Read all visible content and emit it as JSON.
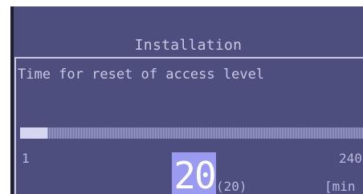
{
  "screen": {
    "title": "Installation",
    "parameter": {
      "label": "Time for reset of access level",
      "min_label": "1",
      "max_label": "240",
      "current_value": "20",
      "default_value": "(20)",
      "unit": "[min"
    },
    "slider": {
      "min": 1,
      "max": 240,
      "value": 20,
      "fill_fraction": 0.08
    }
  },
  "colors": {
    "background": "#4e4e7e",
    "text": "#c8c8e4",
    "value_highlight": "#9a9af0",
    "slider_fill": "#d6d6f0"
  }
}
